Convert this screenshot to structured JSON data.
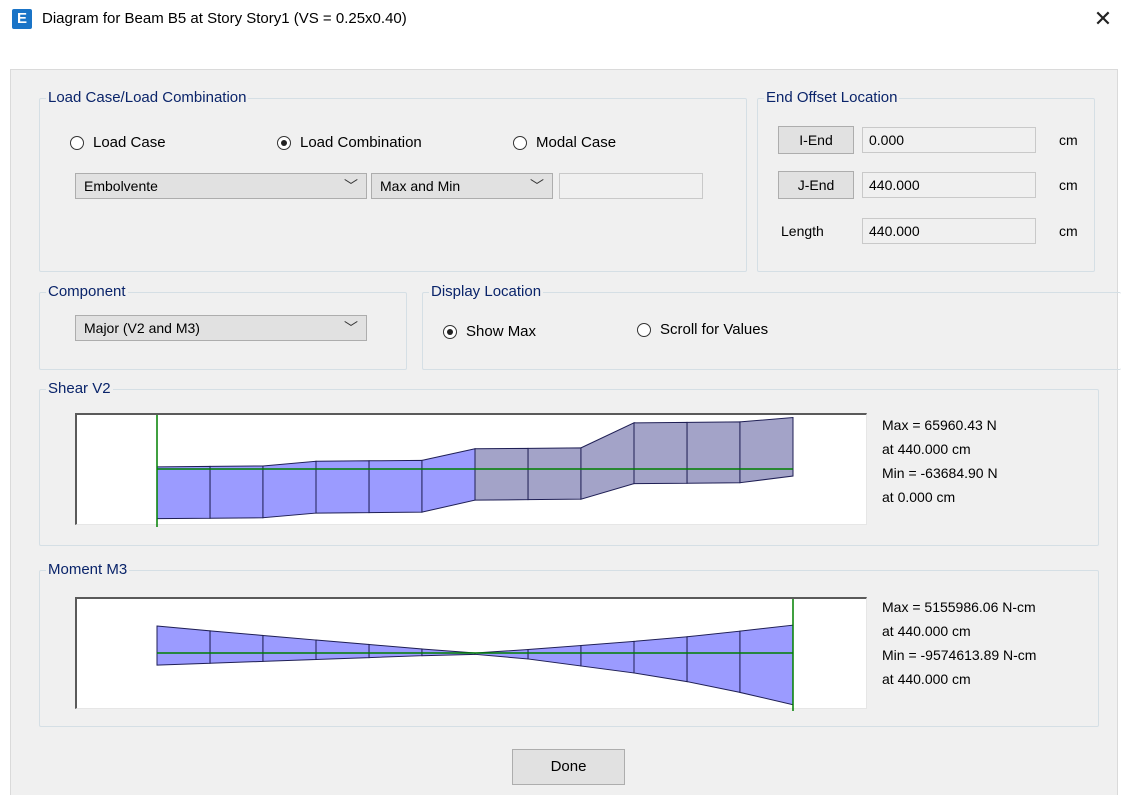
{
  "window": {
    "title": "Diagram for Beam B5 at Story Story1 (VS = 0.25x0.40)",
    "close_glyph": "✕",
    "app_icon_letter": "E"
  },
  "load_group": {
    "label": "Load Case/Load Combination",
    "radios": [
      {
        "label": "Load Case",
        "selected": false
      },
      {
        "label": "Load Combination",
        "selected": true
      },
      {
        "label": "Modal Case",
        "selected": false
      }
    ],
    "combo_value": "Embolvente",
    "type_value": "Max and Min",
    "extra_value": ""
  },
  "end_offset": {
    "label": "End Offset Location",
    "rows": [
      {
        "name": "I-End",
        "value": "0.000",
        "unit": "cm"
      },
      {
        "name": "J-End",
        "value": "440.000",
        "unit": "cm"
      },
      {
        "name": "Length",
        "value": "440.000",
        "unit": "cm"
      }
    ]
  },
  "component": {
    "label": "Component",
    "value": "Major (V2 and M3)"
  },
  "display_location": {
    "label": "Display Location",
    "radios": [
      {
        "label": "Show Max",
        "selected": true
      },
      {
        "label": "Scroll for Values",
        "selected": false
      }
    ]
  },
  "shear": {
    "label": "Shear V2",
    "max": "Max = 65960.43 N",
    "max_at": "at 440.000 cm",
    "min": "Min = -63684.90 N",
    "min_at": "at 0.000 cm"
  },
  "moment": {
    "label": "Moment M3",
    "max": "Max = 5155986.06 N-cm",
    "max_at": "at 440.000 cm",
    "min": "Min = -9574613.89 N-cm",
    "min_at": "at 440.000 cm"
  },
  "done_label": "Done",
  "colors": {
    "fill": "#9b9bff",
    "fill_dim": "#a3a3c8",
    "outline": "#1f1f55",
    "axis": "#008000",
    "label_blue": "#0a246a"
  },
  "chart_data": [
    {
      "type": "area",
      "title": "Shear V2",
      "units": {
        "x": "cm",
        "y": "N"
      },
      "x": [
        0,
        36.7,
        73.3,
        110,
        146.7,
        183.3,
        220,
        256.7,
        293.3,
        330,
        366.7,
        403.3,
        440
      ],
      "series": [
        {
          "name": "Max",
          "values": [
            2700,
            3300,
            3900,
            9900,
            10500,
            11100,
            25900,
            26500,
            27100,
            59200,
            59800,
            60400,
            65960
          ]
        },
        {
          "name": "Min",
          "values": [
            -63685,
            -63100,
            -62500,
            -56500,
            -55900,
            -55300,
            -39900,
            -39300,
            -38700,
            -18800,
            -18200,
            -17600,
            -9000
          ]
        }
      ],
      "ylim": [
        -70000,
        70000
      ]
    },
    {
      "type": "area",
      "title": "Moment M3",
      "units": {
        "x": "cm",
        "y": "N-cm"
      },
      "x": [
        0,
        36.7,
        73.3,
        110,
        146.7,
        183.3,
        220,
        256.7,
        293.3,
        330,
        366.7,
        403.3,
        440
      ],
      "series": [
        {
          "name": "Max",
          "values": [
            5000000,
            4100000,
            3250000,
            2400000,
            1580000,
            750000,
            0,
            650000,
            1380000,
            2150000,
            3000000,
            4050000,
            5155986
          ]
        },
        {
          "name": "Min",
          "values": [
            -2250000,
            -1900000,
            -1550000,
            -1200000,
            -850000,
            -500000,
            -250000,
            -1100000,
            -2400000,
            -3700000,
            -5300000,
            -7300000,
            -9574614
          ]
        }
      ],
      "ylim": [
        -10000000,
        10000000
      ]
    }
  ]
}
